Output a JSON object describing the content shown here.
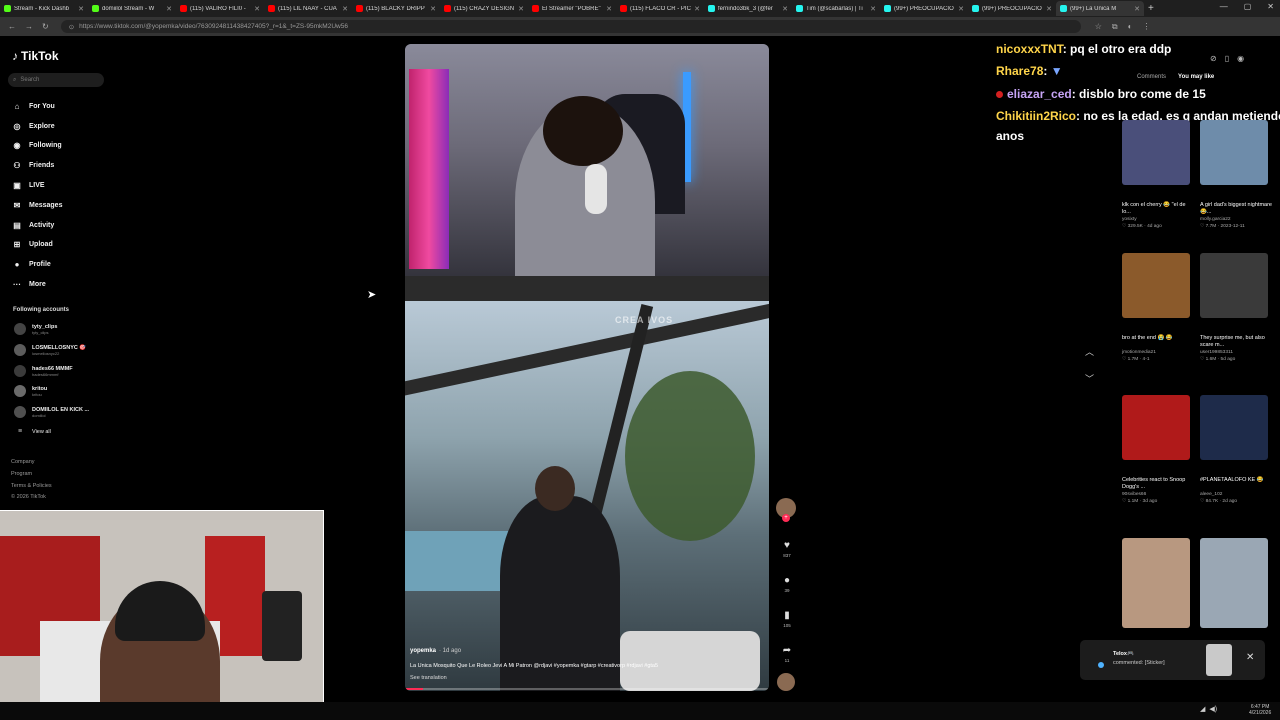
{
  "browser": {
    "tabs": [
      {
        "label": "Stream - Kick Dashb",
        "color": "#53fc18"
      },
      {
        "label": "domiilol Stream - W",
        "color": "#53fc18"
      },
      {
        "label": "(115) VALIRO FILI0 - ",
        "color": "#ff0000"
      },
      {
        "label": "(115) LIL NAAY - CUA",
        "color": "#ff0000"
      },
      {
        "label": "(115) BLACKY DRIPP",
        "color": "#ff0000"
      },
      {
        "label": "(115) CRAZY DESIGN",
        "color": "#ff0000"
      },
      {
        "label": "El Streamer \"POBRE\"",
        "color": "#ff0000"
      },
      {
        "label": "(115) FLACO CR - PIC",
        "color": "#ff0000"
      },
      {
        "label": "fernindo3bk_3 (@fer",
        "color": "#25f4ee"
      },
      {
        "label": "Tim (@scabarlas) | Ti",
        "color": "#25f4ee"
      },
      {
        "label": "(99+) PREOCUPACIÓ",
        "color": "#25f4ee"
      },
      {
        "label": "(99+) PREOCUPACIÓ",
        "color": "#25f4ee"
      },
      {
        "label": "(99+) La Única M",
        "color": "#25f4ee"
      }
    ],
    "url": "https://www.tiktok.com/@yopemka/video/7630924811438427405?_r=1&_t=ZS-95mkM2Uw56"
  },
  "sidebar": {
    "logo": "TikTok",
    "search_placeholder": "Search",
    "nav": [
      {
        "label": "For You",
        "icon": "home-icon",
        "glyph": "⌂"
      },
      {
        "label": "Explore",
        "icon": "compass-icon",
        "glyph": "◎"
      },
      {
        "label": "Following",
        "icon": "following-icon",
        "glyph": "◉"
      },
      {
        "label": "Friends",
        "icon": "friends-icon",
        "glyph": "⚇"
      },
      {
        "label": "LIVE",
        "icon": "live-icon",
        "glyph": "▣"
      },
      {
        "label": "Messages",
        "icon": "messages-icon",
        "glyph": "✉"
      },
      {
        "label": "Activity",
        "icon": "activity-icon",
        "glyph": "▤"
      },
      {
        "label": "Upload",
        "icon": "upload-icon",
        "glyph": "⊞"
      },
      {
        "label": "Profile",
        "icon": "profile-icon",
        "glyph": "●"
      },
      {
        "label": "More",
        "icon": "more-icon",
        "glyph": "···"
      }
    ],
    "following_header": "Following accounts",
    "following": [
      {
        "name": "tyty_clips",
        "sub": "tyty_clips"
      },
      {
        "name": "LOSMELLOSNYC 🎯",
        "sub": "losmellosnyc22"
      },
      {
        "name": "hades66 MMMF",
        "sub": "hades66mmmf"
      },
      {
        "name": "kritou",
        "sub": "kritou"
      },
      {
        "name": "DOMIILOL EN KICK ...",
        "sub": "domiilol"
      }
    ],
    "view_all": "View all",
    "footer": [
      "Company",
      "Program",
      "Terms & Policies",
      "© 2026 TikTok"
    ]
  },
  "video": {
    "watermark": "CREA IVOS",
    "author": "yopemka",
    "date": "· 1d ago",
    "caption": "La Unica Mosquito Que Le Roleo Jevi A Mi Patron @rdjavi #yopemka #gtarp #creativorp #rdjavi #gta5",
    "see_translation": "See translation",
    "progress": 0.05
  },
  "actions": {
    "likes": "837",
    "comments": "39",
    "saves": "105",
    "shares": "11"
  },
  "chat": [
    {
      "user": "nicoxxxTNT",
      "msg": ": pq el otro era ddp",
      "color": "#ffd54a"
    },
    {
      "user": "Rhare78",
      "msg": ":",
      "color": "#ffd54a"
    },
    {
      "user": "eliazar_ced",
      "msg": ": disblo bro come de 15",
      "color": "#c6a4f5"
    },
    {
      "user": "Chikitiin2Rico",
      "msg": ": no es la edad, es q andan metiendos",
      "color": "#ffd54a"
    },
    {
      "user": "",
      "msg": "anos",
      "color": "#ffffff"
    }
  ],
  "right_panel": {
    "tabs": [
      "Comments",
      "You may like"
    ],
    "videos": [
      {
        "caption": "klk con el cherry 😂 \"el de lo...",
        "author": "yosixty",
        "stats": "♡ 329.5K · 4d ago",
        "color": "#4a4f7a"
      },
      {
        "caption": "A girl dad's biggest nightmare 😂...",
        "author": "molly.garcia22",
        "stats": "♡ 7.7M · 2023-12-11",
        "color": "#6e8caa"
      },
      {
        "caption": "bro at the end 😭 😂",
        "author": "jmotionmedia21",
        "stats": "♡ 1.7M · 4-1",
        "color": "#8b5a2b"
      },
      {
        "caption": "They surprise me, but also scare m...",
        "author": "user199853311",
        "stats": "♡ 1.6M · 5d ago",
        "color": "#3a3a3a"
      },
      {
        "caption": "Celebrities react to Snoop Dogg's ...",
        "author": "90svibes66",
        "stats": "♡ 1.1M · 3d ago",
        "color": "#b01a1a"
      },
      {
        "caption": "#PLANETAALOFO KE 😂",
        "author": "aleee_102",
        "stats": "♡ 84.7K · 2d ago",
        "color": "#1e2b4a"
      },
      {
        "caption": "",
        "author": "",
        "stats": "",
        "color": "#b89880"
      },
      {
        "caption": "",
        "author": "",
        "stats": "",
        "color": "#9aa7b4"
      }
    ]
  },
  "notification": {
    "user": "Telox🎮",
    "text": "commented: [Sticker]"
  },
  "taskbar": {
    "time": "6:47 PM",
    "date": "4/21/2026"
  }
}
